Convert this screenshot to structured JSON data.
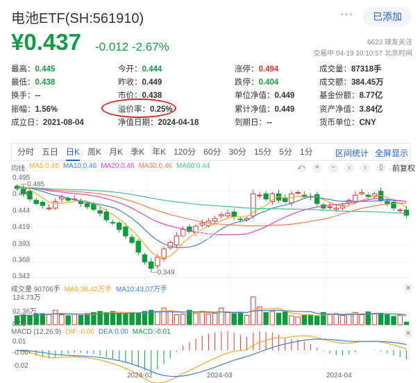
{
  "header": {
    "title": "电池ETF(SH:561910)",
    "more": "···",
    "added_button": "已添加",
    "price": "¥0.437",
    "change": "-0.012 -2.67%",
    "followers": "6623 球友关注",
    "status": "交易中 04-19 10:10:57 北京时间"
  },
  "stats": [
    {
      "label": "最高：",
      "value": "0.445",
      "color": "g"
    },
    {
      "label": "今开：",
      "value": "0.444",
      "color": "g"
    },
    {
      "label": "涨停：",
      "value": "0.494",
      "color": "r"
    },
    {
      "label": "成交量：",
      "value": "87318手",
      "color": ""
    },
    {
      "label": "最低：",
      "value": "0.438",
      "color": "g"
    },
    {
      "label": "昨收：",
      "value": "0.449",
      "color": ""
    },
    {
      "label": "跌停：",
      "value": "0.404",
      "color": "g"
    },
    {
      "label": "成交额：",
      "value": "384.45万",
      "color": ""
    },
    {
      "label": "换手：",
      "value": "--",
      "color": ""
    },
    {
      "label": "市价：",
      "value": "0.438",
      "color": ""
    },
    {
      "label": "单位净值：",
      "value": "0.449",
      "color": ""
    },
    {
      "label": "基金份额：",
      "value": "8.77亿",
      "color": ""
    },
    {
      "label": "振幅：",
      "value": "1.56%",
      "color": ""
    },
    {
      "label": "溢价率：",
      "value": "0.25%",
      "color": ""
    },
    {
      "label": "累计净值：",
      "value": "0.449",
      "color": ""
    },
    {
      "label": "资产净值：",
      "value": "3.84亿",
      "color": ""
    },
    {
      "label": "成立日：",
      "value": "2021-08-04",
      "color": ""
    },
    {
      "label": "净值日期：",
      "value": "2024-04-18",
      "color": ""
    },
    {
      "label": "到期日：",
      "value": "--",
      "color": ""
    },
    {
      "label": "货币单位：",
      "value": "CNY",
      "color": ""
    }
  ],
  "tabs": [
    "分时",
    "五日",
    "日K",
    "周K",
    "月K",
    "季K",
    "年K",
    "120分",
    "60分",
    "30分",
    "15分",
    "5分",
    "1分"
  ],
  "active_tab": 2,
  "tab_right": [
    "区间统计",
    "全屏显示"
  ],
  "legend": {
    "title": "均线",
    "items": [
      {
        "text": "MA5:0.45",
        "color": "#f5a623"
      },
      {
        "text": "MA10:0.46",
        "color": "#3b7fd9"
      },
      {
        "text": "MA20:0.46",
        "color": "#e040c8"
      },
      {
        "text": "MA30:0.46",
        "color": "#f77b52"
      },
      {
        "text": "MA60:0.44",
        "color": "#3cc48a"
      }
    ]
  },
  "controls": {
    "icons": [
      "undo-icon",
      "zoom-in-icon",
      "zoom-out-icon",
      "left-icon",
      "right-icon",
      "drag-icon"
    ],
    "glyphs": [
      "⤺",
      "+",
      "−",
      "‹",
      "›",
      "▯"
    ],
    "adjust": "前复权"
  },
  "colors": {
    "up": "#e5322d",
    "down": "#0c9c3b"
  },
  "price_axis": {
    "ticks": [
      "0.495",
      "0.470",
      "0.444",
      "0.419",
      "0.393",
      "0.368",
      "0.343"
    ],
    "max_label": "0.485",
    "min_label": "0.349"
  },
  "volume": {
    "title": "成交量 90706手",
    "ma5": "MA5:36.42万手",
    "ma10": "MA10:43.07万手",
    "ticks": [
      "124.73万",
      "62.36万",
      "0.00"
    ]
  },
  "macd": {
    "title": "MACD (12,26,9)",
    "dif": "DIF:-0.00",
    "dea": "DEA:0.00",
    "macd": "MACD:-0.01",
    "ticks": [
      "0.01",
      "-0.00",
      "-0.02"
    ]
  },
  "x_labels": [
    "2024-02",
    "2024-03",
    "2024-04"
  ],
  "chart_data": {
    "type": "candlestick",
    "ylim": [
      0.343,
      0.495
    ],
    "closes": [
      0.478,
      0.47,
      0.462,
      0.455,
      0.452,
      0.448,
      0.458,
      0.465,
      0.46,
      0.462,
      0.455,
      0.45,
      0.446,
      0.44,
      0.43,
      0.425,
      0.415,
      0.405,
      0.395,
      0.38,
      0.365,
      0.355,
      0.372,
      0.385,
      0.395,
      0.405,
      0.415,
      0.412,
      0.42,
      0.425,
      0.428,
      0.432,
      0.438,
      0.44,
      0.435,
      0.43,
      0.432,
      0.47,
      0.468,
      0.462,
      0.47,
      0.46,
      0.458,
      0.47,
      0.472,
      0.466,
      0.465,
      0.455,
      0.448,
      0.45,
      0.448,
      0.452,
      0.46,
      0.468,
      0.472,
      0.466,
      0.47,
      0.46,
      0.455,
      0.448,
      0.445,
      0.437
    ],
    "volumes": [
      40,
      45,
      42,
      50,
      50,
      48,
      65,
      45,
      40,
      48,
      42,
      50,
      55,
      60,
      55,
      60,
      52,
      48,
      55,
      52,
      60,
      65,
      60,
      75,
      58,
      45,
      48,
      65,
      52,
      60,
      48,
      52,
      75,
      55,
      50,
      52,
      42,
      125,
      80,
      55,
      60,
      52,
      58,
      40,
      35,
      42,
      45,
      40,
      55,
      48,
      50,
      42,
      50,
      55,
      45,
      58,
      48,
      52,
      45,
      38,
      42,
      12
    ],
    "volume_max": 124.73
  }
}
